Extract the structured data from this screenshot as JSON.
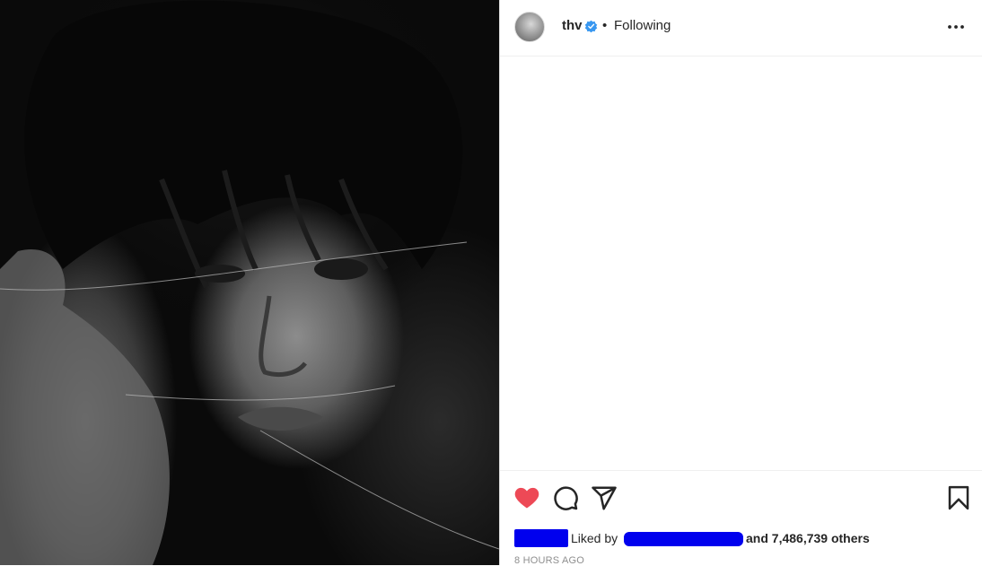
{
  "post": {
    "photo_alt": "",
    "header": {
      "username": "thv",
      "separator": "•",
      "follow_status": "Following"
    },
    "actions": {
      "like_icon": "heart-filled-icon",
      "comment_icon": "comment-icon",
      "share_icon": "paper-plane-icon",
      "save_icon": "bookmark-icon"
    },
    "likes": {
      "liked_by_label": "Liked by",
      "others_text": "and 7,486,739 others"
    },
    "timestamp": "8 HOURS AGO"
  },
  "colors": {
    "like_red": "#ed4956",
    "verified_blue": "#3897f0",
    "redaction_blue": "#0000ee",
    "text_primary": "#262626",
    "text_secondary": "#8e8e8e"
  }
}
